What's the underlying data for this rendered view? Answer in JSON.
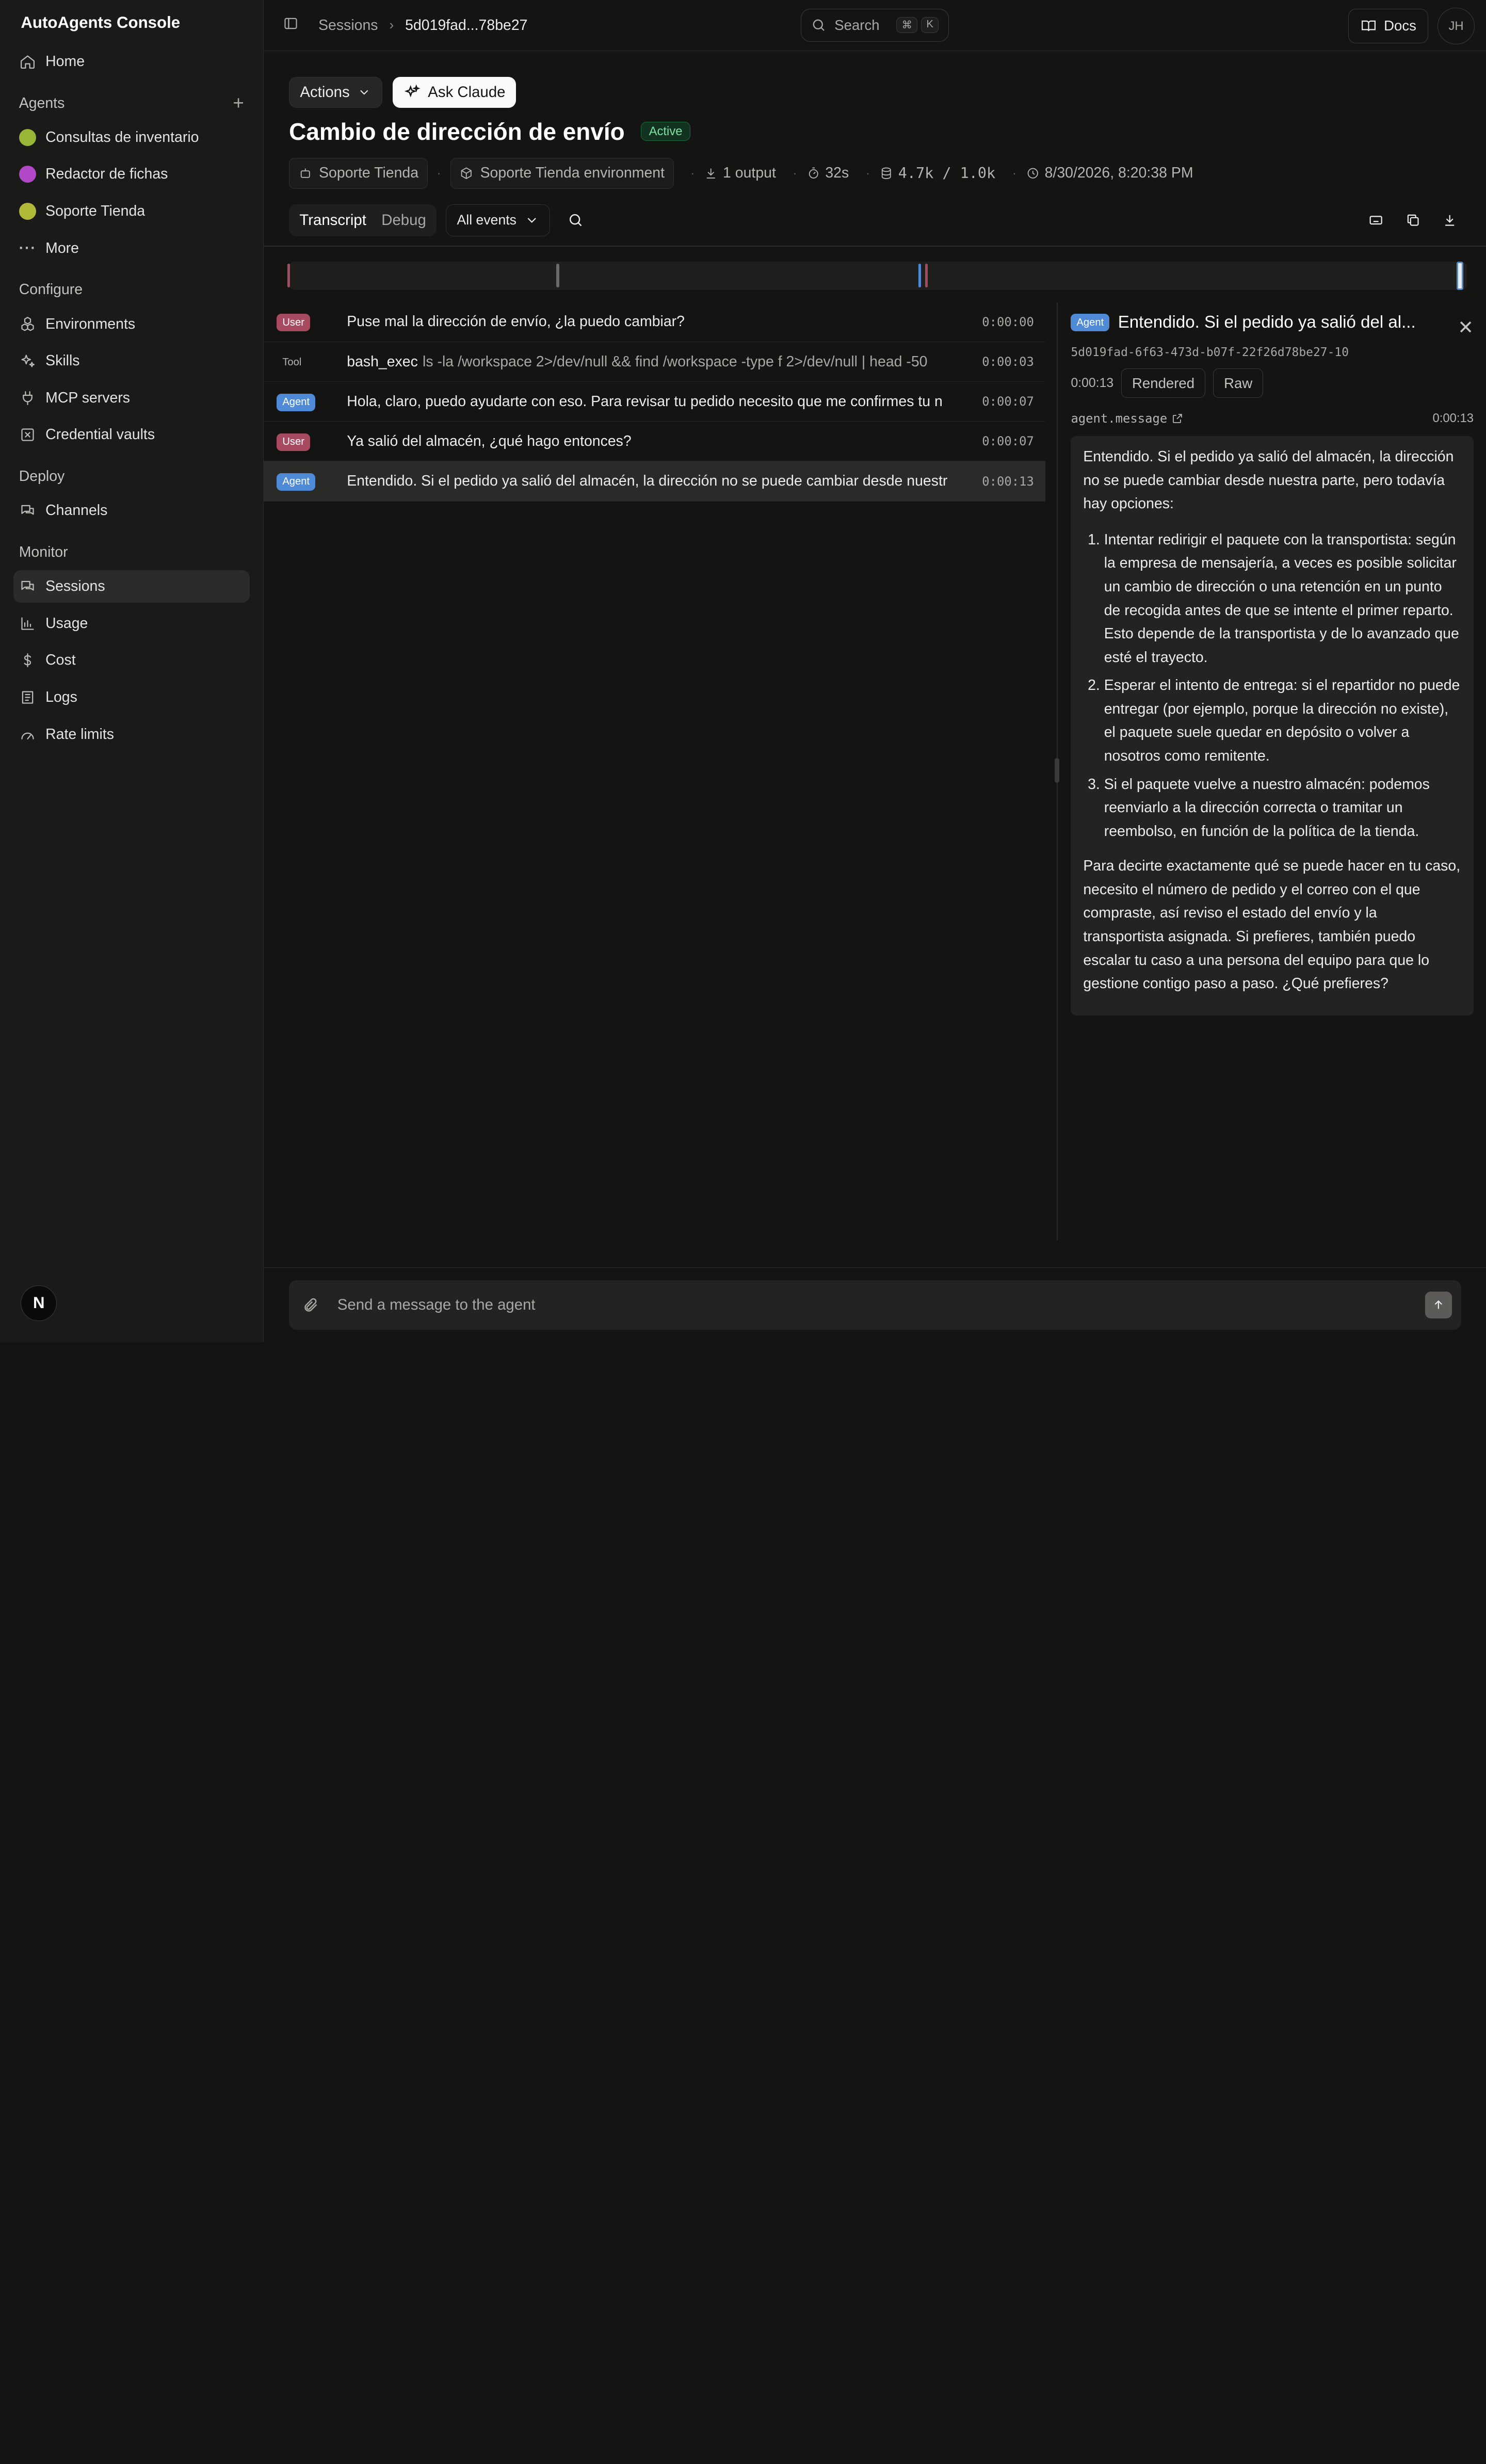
{
  "app": {
    "title": "AutoAgents Console"
  },
  "sidebar": {
    "home": "Home",
    "agents_label": "Agents",
    "agents": [
      {
        "label": "Consultas de inventario",
        "color": "#9ab636"
      },
      {
        "label": "Redactor de fichas",
        "color": "#b048c8"
      },
      {
        "label": "Soporte Tienda",
        "color": "#b2b838"
      }
    ],
    "more": "More",
    "configure_label": "Configure",
    "configure": [
      "Environments",
      "Skills",
      "MCP servers",
      "Credential vaults"
    ],
    "deploy_label": "Deploy",
    "deploy": [
      "Channels"
    ],
    "monitor_label": "Monitor",
    "monitor": [
      "Sessions",
      "Usage",
      "Cost",
      "Logs",
      "Rate limits"
    ],
    "footer_avatar": "N"
  },
  "topbar": {
    "crumb_root": "Sessions",
    "crumb_current": "5d019fad...78be27",
    "search_placeholder": "Search",
    "kbd_1": "⌘",
    "kbd_2": "K",
    "docs": "Docs",
    "avatar": "JH"
  },
  "session": {
    "actions": "Actions",
    "ask": "Ask Claude",
    "title": "Cambio de dirección de envío",
    "status": "Active",
    "agent": "Soporte Tienda",
    "environment": "Soporte Tienda environment",
    "outputs": "1 output",
    "duration": "32s",
    "tokens": "4.7k / 1.0k",
    "timestamp": "8/30/2026, 8:20:38 PM"
  },
  "tabs": {
    "transcript": "Transcript",
    "debug": "Debug",
    "filter": "All events"
  },
  "events": [
    {
      "role": "User",
      "text": "Puse mal la dirección de envío, ¿la puedo cambiar?",
      "time": "0:00:00"
    },
    {
      "role": "Tool",
      "tool": "bash_exec",
      "args": "ls -la /workspace 2>/dev/null && find /workspace -type f 2>/dev/null | head -50",
      "time": "0:00:03"
    },
    {
      "role": "Agent",
      "text": "Hola, claro, puedo ayudarte con eso. Para revisar tu pedido necesito que me confirmes tu n",
      "time": "0:00:07"
    },
    {
      "role": "User",
      "text": "Ya salió del almacén, ¿qué hago entonces?",
      "time": "0:00:07"
    },
    {
      "role": "Agent",
      "text": "Entendido. Si el pedido ya salió del almacén, la dirección no se puede cambiar desde nuestr",
      "time": "0:00:13"
    }
  ],
  "detail": {
    "role": "Agent",
    "title": "Entendido. Si el pedido ya salió del al...",
    "id": "5d019fad-6f63-473d-b07f-22f26d78be27-10",
    "time": "0:00:13",
    "rendered": "Rendered",
    "raw": "Raw",
    "type": "agent.message",
    "type_time": "0:00:13",
    "intro": "Entendido. Si el pedido ya salió del almacén, la dirección no se puede cambiar desde nuestra parte, pero todavía hay opciones:",
    "items": [
      "Intentar redirigir el paquete con la transportista: según la empresa de mensajería, a veces es posible solicitar un cambio de dirección o una retención en un punto de recogida antes de que se intente el primer reparto. Esto depende de la transportista y de lo avanzado que esté el trayecto.",
      "Esperar el intento de entrega: si el repartidor no puede entregar (por ejemplo, porque la dirección no existe), el paquete suele quedar en depósito o volver a nosotros como remitente.",
      "Si el paquete vuelve a nuestro almacén: podemos reenviarlo a la dirección correcta o tramitar un reembolso, en función de la política de la tienda."
    ],
    "outro": "Para decirte exactamente qué se puede hacer en tu caso, necesito el número de pedido y el correo con el que compraste, así reviso el estado del envío y la transportista asignada. Si prefieres, también puedo escalar tu caso a una persona del equipo para que lo gestione contigo paso a paso. ¿Qué prefieres?"
  },
  "composer": {
    "placeholder": "Send a message to the agent"
  },
  "colors": {
    "user": "#a94b60",
    "agent": "#4f8ad6",
    "tool_tick": "#6b6a66"
  }
}
